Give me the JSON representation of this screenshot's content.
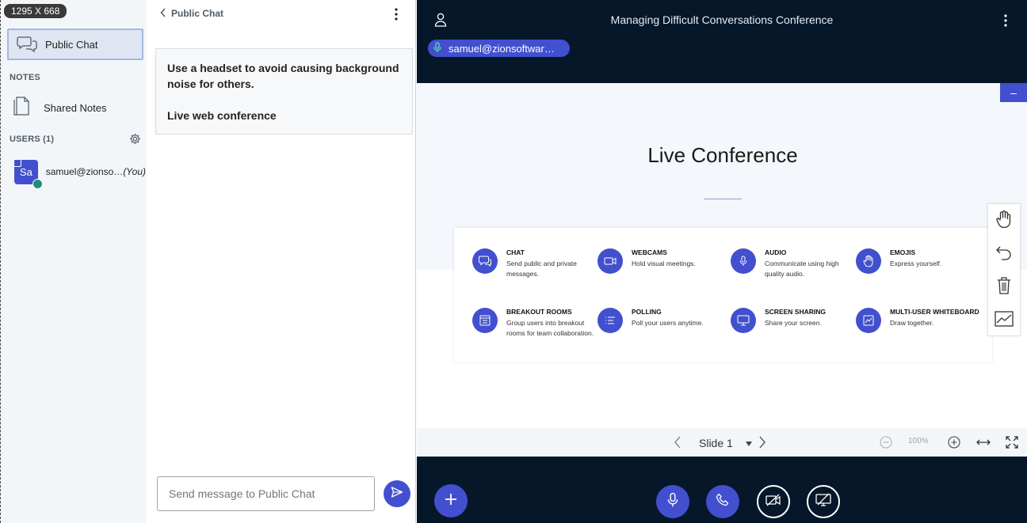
{
  "badge": "1295 X 668",
  "sidebar": {
    "public_chat": "Public Chat",
    "notes_header": "NOTES",
    "shared_notes": "Shared Notes",
    "users_header": "USERS (1)",
    "user_name": "samuel@zionso…",
    "user_you": "(You)",
    "avatar_initials": "Sa"
  },
  "chat": {
    "title": "Public Chat",
    "welcome_line1": "Use a headset to avoid causing background noise for others.",
    "welcome_line2": "Live web conference",
    "input_placeholder": "Send message to Public Chat"
  },
  "main": {
    "conference_title": "Managing Difficult Conversations Conference",
    "talker": "samuel@zionsoftwar…",
    "slide_title": "Live Conference",
    "minimize": "–",
    "features": [
      {
        "icon": "chat-icon",
        "title": "CHAT",
        "desc": "Send public and private messages."
      },
      {
        "icon": "webcam-icon",
        "title": "WEBCAMS",
        "desc": "Hold visual meetings."
      },
      {
        "icon": "microphone-icon",
        "title": "AUDIO",
        "desc": "Communicate using high quality audio."
      },
      {
        "icon": "hand-icon",
        "title": "EMOJIS",
        "desc": "Express yourself."
      },
      {
        "icon": "breakout-icon",
        "title": "BREAKOUT ROOMS",
        "desc": "Group users into breakout rooms for team collaboration."
      },
      {
        "icon": "polling-icon",
        "title": "POLLING",
        "desc": "Poll your users anytime."
      },
      {
        "icon": "screen-share-icon",
        "title": "SCREEN SHARING",
        "desc": "Share your screen."
      },
      {
        "icon": "whiteboard-icon",
        "title": "MULTI-USER WHITEBOARD",
        "desc": "Draw together."
      }
    ],
    "slide_label": "Slide 1",
    "zoom": "100%"
  },
  "colors": {
    "accent": "#4250cf",
    "dark_bg": "#06172a",
    "voice_green": "#1e8f7c"
  }
}
